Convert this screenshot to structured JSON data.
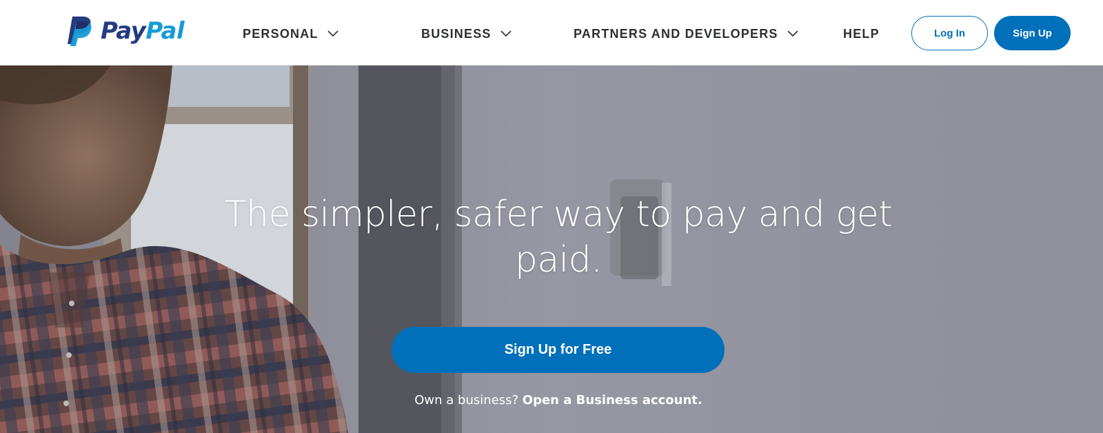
{
  "brand": {
    "logo_word_pay": "Pay",
    "logo_word_pal": "Pal",
    "logo_icon": "paypal-p-monogram",
    "colors": {
      "navy": "#253b80",
      "light_blue": "#179bd7",
      "primary": "#0070ba"
    }
  },
  "nav": {
    "items": [
      {
        "label": "PERSONAL",
        "has_dropdown": true,
        "icon": "chevron-down-icon"
      },
      {
        "label": "BUSINESS",
        "has_dropdown": true,
        "icon": "chevron-down-icon"
      },
      {
        "label": "PARTNERS AND DEVELOPERS",
        "has_dropdown": true,
        "icon": "chevron-down-icon"
      },
      {
        "label": "HELP",
        "has_dropdown": false
      }
    ],
    "login_label": "Log In",
    "signup_label": "Sign Up"
  },
  "hero": {
    "title": "The simpler, safer way to pay and get paid.",
    "cta_label": "Sign Up for Free",
    "sub_text": "Own a business?",
    "sub_link": "Open a Business account."
  }
}
